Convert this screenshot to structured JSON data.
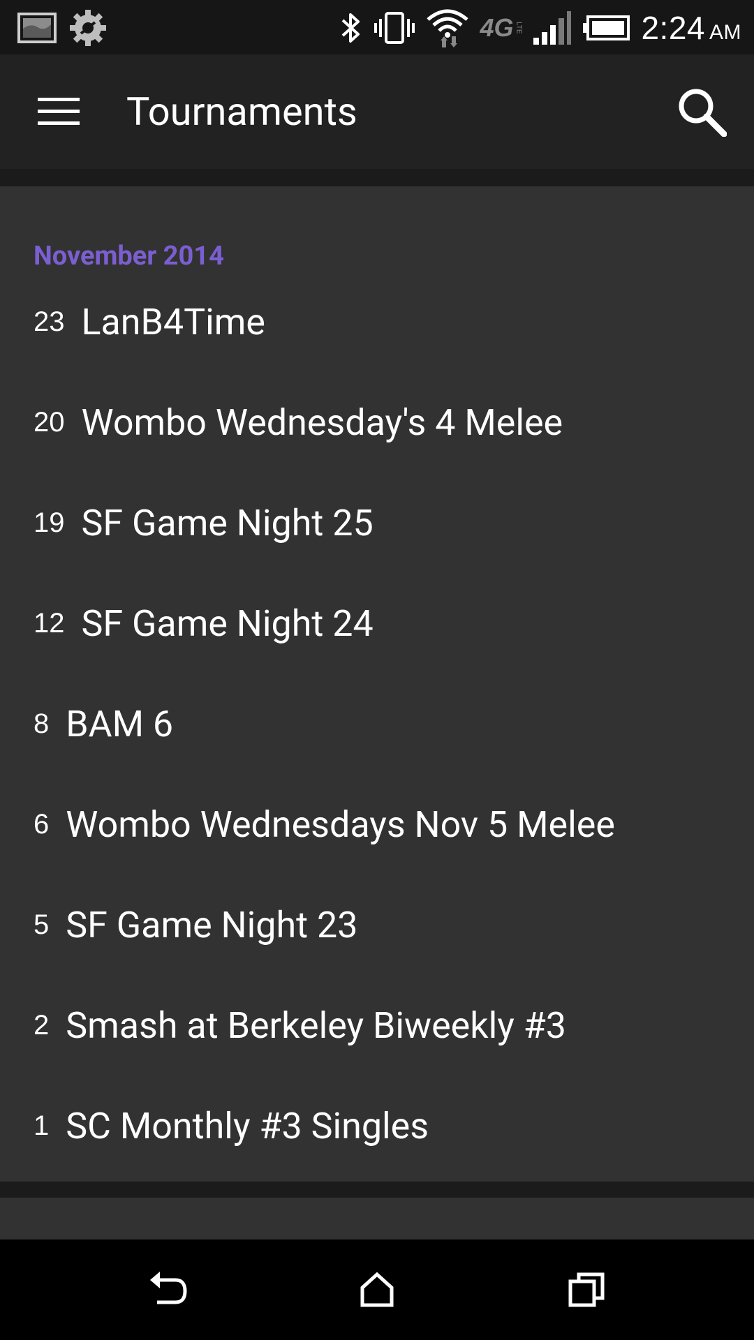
{
  "status_bar": {
    "time": "2:24",
    "ampm": "AM",
    "network": "4G",
    "network_sub": "LTE"
  },
  "app_bar": {
    "title": "Tournaments",
    "menu_icon": "hamburger-menu-icon",
    "search_icon": "search-icon"
  },
  "sections": [
    {
      "header": "November 2014",
      "items": [
        {
          "day": "23",
          "name": "LanB4Time"
        },
        {
          "day": "20",
          "name": "Wombo Wednesday's 4 Melee"
        },
        {
          "day": "19",
          "name": "SF Game Night 25"
        },
        {
          "day": "12",
          "name": "SF Game Night 24"
        },
        {
          "day": "8",
          "name": "BAM 6"
        },
        {
          "day": "6",
          "name": "Wombo Wednesdays Nov 5 Melee"
        },
        {
          "day": "5",
          "name": "SF Game Night 23"
        },
        {
          "day": "2",
          "name": "Smash at Berkeley Biweekly #3"
        },
        {
          "day": "1",
          "name": "SC Monthly #3 Singles"
        }
      ]
    }
  ],
  "colors": {
    "accent": "#7b5fd1",
    "card": "#323232",
    "app_bar": "#222222",
    "background": "#1b1b1b"
  },
  "nav_bar": {
    "back_icon": "back-icon",
    "home_icon": "home-icon",
    "recents_icon": "recents-icon"
  }
}
